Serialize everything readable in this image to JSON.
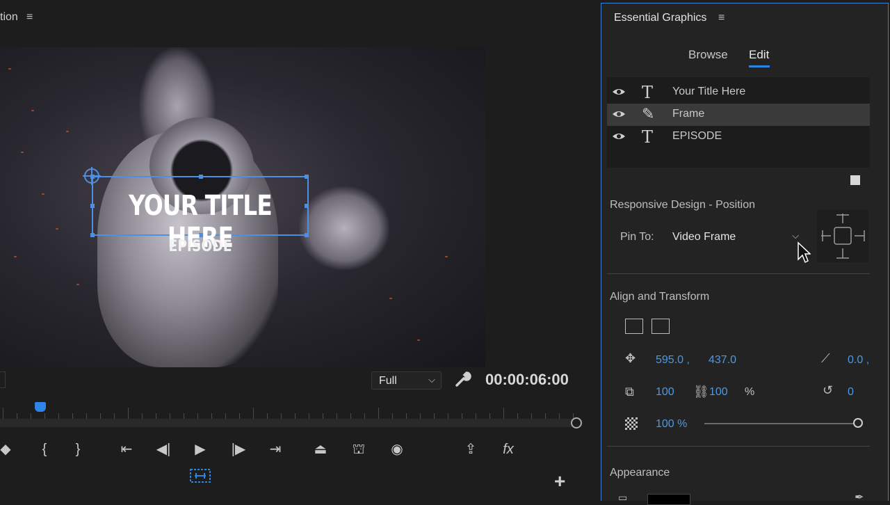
{
  "monitor": {
    "title": "tion",
    "menu_glyph": "≡",
    "video": {
      "title_text": "YOUR TITLE HERE",
      "episode_text": "EPISODE"
    },
    "zoom": "Full",
    "timecode": "00:00:06:00"
  },
  "transport": {
    "buttons": [
      "mark-in",
      "mark-out",
      "go-to-in",
      "step-back",
      "play",
      "step-forward",
      "go-to-out",
      "lift",
      "extract",
      "export-frame",
      "insert",
      "fx"
    ]
  },
  "essential_graphics": {
    "title": "Essential Graphics",
    "menu_glyph": "≡",
    "tabs": [
      {
        "label": "Browse"
      },
      {
        "label": "Edit"
      }
    ],
    "active_tab": "Edit",
    "layers": [
      {
        "type_glyph": "T",
        "label": "Your Title Here",
        "selected": false
      },
      {
        "type_glyph": "✎",
        "label": "Frame",
        "selected": true
      },
      {
        "type_glyph": "T",
        "label": "EPISODE",
        "selected": false
      }
    ],
    "responsive_design": {
      "heading": "Responsive Design - Position",
      "pin_label": "Pin To:",
      "pin_value": "Video Frame"
    },
    "align_transform": {
      "heading": "Align and Transform",
      "position_x": "595.0 ,",
      "position_y": "437.0",
      "anchor": "0.0 ,",
      "scale_w": "100",
      "scale_h": "100",
      "scale_unit": "%",
      "rotation": "0",
      "opacity": "100 %",
      "opacity_fraction": 1.0
    },
    "appearance": {
      "heading": "Appearance",
      "fill_color": "#000000"
    }
  },
  "colors": {
    "accent": "#2d86e6",
    "selection": "#4f8fe2",
    "value_blue": "#4a9ae8"
  }
}
